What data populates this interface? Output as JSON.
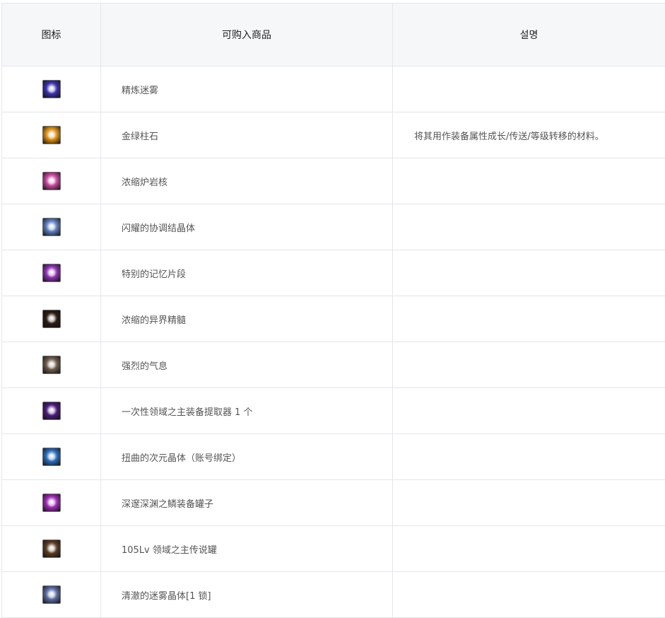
{
  "table": {
    "headers": {
      "icon": "图标",
      "item": "可购入商品",
      "desc": "설명"
    },
    "rows": [
      {
        "icon": "bright-star-orb-icon",
        "color": "#3a2fa8",
        "name": "精炼迷雾",
        "desc": ""
      },
      {
        "icon": "golden-gem-icon",
        "color": "#d98a12",
        "name": "金绿柱石",
        "desc": "将其用作装备属性成长/传送/等级转移的材料。"
      },
      {
        "icon": "pink-crystal-core-icon",
        "color": "#c2449a",
        "name": "浓缩炉岩核",
        "desc": ""
      },
      {
        "icon": "golden-harmony-crystal-icon",
        "color": "#5a7ab8",
        "name": "闪耀的协调结晶体",
        "desc": ""
      },
      {
        "icon": "memory-shard-icon",
        "color": "#8a2fb0",
        "name": "特别的记忆片段",
        "desc": ""
      },
      {
        "icon": "dark-otherworld-essence-icon",
        "color": "#2a1a12",
        "name": "浓缩的异界精髓",
        "desc": ""
      },
      {
        "icon": "radiant-aura-icon",
        "color": "#6a5a4a",
        "name": "强烈的气息",
        "desc": ""
      },
      {
        "icon": "purple-extractor-icon",
        "color": "#4a1a7a",
        "name": "一次性领域之主装备提取器 1 个",
        "desc": ""
      },
      {
        "icon": "twisted-dimension-crystal-icon",
        "color": "#2a6ab8",
        "name": "扭曲的次元晶体（账号绑定）",
        "desc": ""
      },
      {
        "icon": "abyss-equipment-jar-icon",
        "color": "#9a2ab0",
        "name": "深邃深渊之鳞装备罐子",
        "desc": ""
      },
      {
        "icon": "legend-jar-icon",
        "color": "#5a3a22",
        "name": "105Lv 领域之主传说罐",
        "desc": ""
      },
      {
        "icon": "clear-mist-crystal-icon",
        "color": "#5a6aa0",
        "name": "清澈的迷雾晶体[1 锁]",
        "desc": ""
      }
    ]
  }
}
